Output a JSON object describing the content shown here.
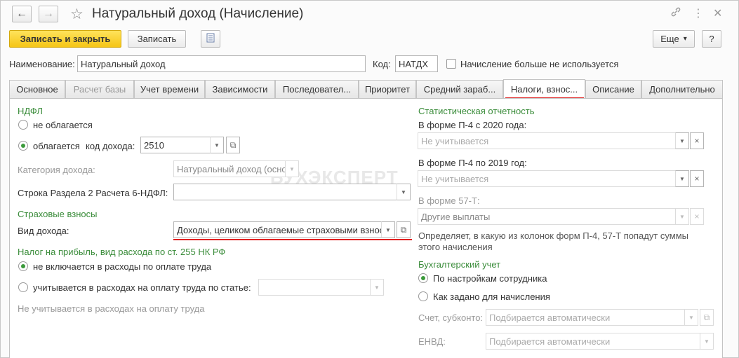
{
  "window": {
    "title": "Натуральный доход (Начисление)"
  },
  "toolbar": {
    "save_close": "Записать и закрыть",
    "save": "Записать",
    "more": "Еще",
    "more_arrow": "▾",
    "help": "?"
  },
  "form": {
    "name_label": "Наименование:",
    "name_value": "Натуральный доход",
    "code_label": "Код:",
    "code_value": "НАТДХ",
    "not_used_label": "Начисление больше не используется"
  },
  "tabs": [
    {
      "label": "Основное"
    },
    {
      "label": "Расчет базы"
    },
    {
      "label": "Учет времени"
    },
    {
      "label": "Зависимости"
    },
    {
      "label": "Последовател..."
    },
    {
      "label": "Приоритет"
    },
    {
      "label": "Средний зараб..."
    },
    {
      "label": "Налоги, взнос..."
    },
    {
      "label": "Описание"
    },
    {
      "label": "Дополнительно"
    }
  ],
  "left": {
    "ndfl_header": "НДФЛ",
    "not_taxed": "не облагается",
    "taxed": "облагается",
    "income_code_label": "код дохода:",
    "income_code_value": "2510",
    "category_label": "Категория дохода:",
    "category_value": "Натуральный доход (осно",
    "row6_label": "Строка Раздела 2 Расчета 6-НДФЛ:",
    "row6_value": "",
    "insurance_header": "Страховые взносы",
    "income_type_label": "Вид дохода:",
    "income_type_value": "Доходы, целиком облагаемые страховыми взносами",
    "profit_header": "Налог на прибыль, вид расхода по ст. 255 НК РФ",
    "not_included": "не включается в расходы по оплате труда",
    "included": "учитывается в расходах на оплату труда по статье:",
    "article_value": "",
    "profit_note": "Не учитывается в расходах на оплату труда"
  },
  "right": {
    "stat_header": "Статистическая отчетность",
    "p4_2020_label": "В форме П-4 с 2020 года:",
    "p4_2020_value": "Не учитывается",
    "p4_2019_label": "В форме П-4 по 2019 год:",
    "p4_2019_value": "Не учитывается",
    "f57_label": "В форме 57-Т:",
    "f57_value": "Другие выплаты",
    "stat_note_1": "Определяет, в какую из колонок форм П-4, 57-Т попадут суммы",
    "stat_note_2": "этого начисления",
    "acc_header": "Бухгалтерский учет",
    "by_employee": "По настройкам сотрудника",
    "by_accrual": "Как задано для начисления",
    "account_label": "Счет, субконто:",
    "account_value": "Подбирается автоматически",
    "envd_label": "ЕНВД:",
    "envd_value": "Подбирается автоматически"
  },
  "watermark": "БУХЭКСПЕРТ",
  "colors": {
    "primary": "#f5c515",
    "section_header": "#3a8c3a",
    "highlight": "#e02020"
  }
}
